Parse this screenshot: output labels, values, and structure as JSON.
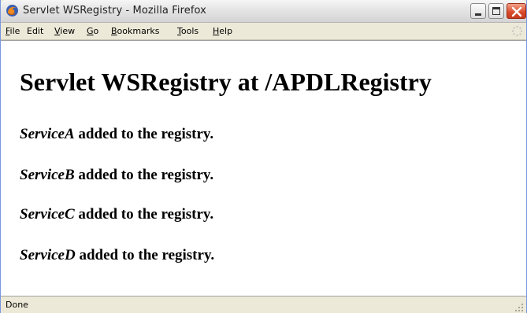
{
  "window": {
    "title": "Servlet WSRegistry - Mozilla Firefox",
    "icon": "firefox-icon",
    "controls": [
      "minimize-icon",
      "maximize-icon",
      "close-icon"
    ]
  },
  "menu": [
    {
      "key": "F",
      "rest": "ile"
    },
    {
      "key": "E",
      "rest": "dit",
      "plain": true
    },
    {
      "key": "V",
      "rest": "iew"
    },
    {
      "key": "G",
      "rest": "o"
    },
    {
      "key": "B",
      "rest": "ookmarks"
    },
    {
      "key": "T",
      "rest": "ools"
    },
    {
      "key": "H",
      "rest": "elp"
    }
  ],
  "page": {
    "heading": "Servlet WSRegistry at /APDLRegistry",
    "suffix": "added to the registry.",
    "services": [
      "ServiceA",
      "ServiceB",
      "ServiceC",
      "ServiceD"
    ]
  },
  "status": {
    "text": "Done"
  },
  "colors": {
    "close_button": "#d8482a",
    "menu_bg": "#ece9d8",
    "page_bg": "#ffffff"
  }
}
